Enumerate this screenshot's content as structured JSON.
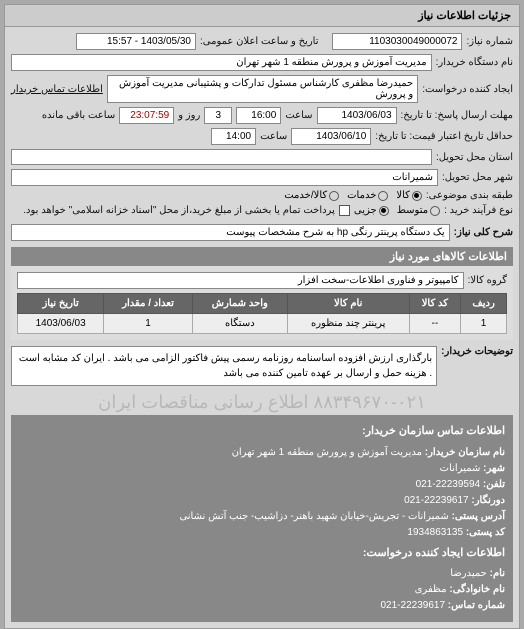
{
  "panel": {
    "title": "جزئیات اطلاعات نیاز"
  },
  "top": {
    "req_no_label": "شماره نیاز:",
    "req_no": "1103030049000072",
    "announce_label": "تاریخ و ساعت اعلان عمومی:",
    "announce": "1403/05/30 - 15:57",
    "dept_label": "نام دستگاه خریدار:",
    "dept": "مدیریت آموزش و پرورش منطقه 1 شهر تهران",
    "creator_label": "ایجاد کننده درخواست:",
    "creator": "حمیدرضا مظفری کارشناس مسئول تدارکات و پشتیبانی مدیریت آموزش و پرورش",
    "buyer_contact_label": "اطلاعات تماس خریدار",
    "deadline_from_label": "مهلت ارسال پاسخ: تا تاریخ:",
    "deadline_date": "1403/06/03",
    "time_label": "ساعت",
    "deadline_time": "16:00",
    "days_label": "روز و",
    "days": "3",
    "remain_time": "23:07:59",
    "remain_label": "ساعت باقی مانده",
    "validity_label": "حداقل تاریخ اعتبار قیمت: تا تاریخ:",
    "validity_date": "1403/06/10",
    "validity_time": "14:00",
    "province_label": "استان محل تحویل:",
    "province": "",
    "city_label": "شهر محل تحویل:",
    "city": "شمیرانات",
    "packaging_label": "طبقه بندی موضوعی:",
    "radio_goods": "کالا",
    "radio_services": "خدمات",
    "radio_goods_services": "کالا/خدمت",
    "purchase_type_label": "نوع فرآیند خرید :",
    "radio_medium": "متوسط",
    "radio_partial": "جزیی",
    "purchase_note": "پرداخت تمام یا بخشی از مبلغ خرید،از محل \"اسناد خزانه اسلامی\" خواهد بود.",
    "desc_label": "شرح کلی نیاز:",
    "desc": "یک دستگاه پرینتر رنگی hp به شرح مشخصات پیوست"
  },
  "goods_section": {
    "title": "اطلاعات کالاهای مورد نیاز",
    "group_label": "گروه کالا:",
    "group": "کامپیوتر و فناوری اطلاعات-سخت افزار",
    "table": {
      "headers": [
        "ردیف",
        "کد کالا",
        "نام کالا",
        "واحد شمارش",
        "تعداد / مقدار",
        "تاریخ نیاز"
      ],
      "rows": [
        [
          "1",
          "--",
          "پرینتر چند منظوره",
          "دستگاه",
          "1",
          "1403/06/03"
        ]
      ]
    }
  },
  "notes": {
    "label": "توضیحات خریدار:",
    "text": "بارگذاری ارزش افزوده اساسنامه روزنامه رسمی پیش فاکتور الزامی می باشد . ایران کد مشابه است . هزینه حمل و ارسال بر عهده تامین کننده می باشد"
  },
  "watermark": "۸۸۳۴۹۶۷۰-۰۲۱ اطلاع رسانی مناقصات ایران",
  "contact": {
    "heading": "اطلاعات تماس سازمان خریدار:",
    "org_label": "نام سازمان خریدار:",
    "org": "مدیریت آموزش و پرورش منطقه 1 شهر تهران",
    "city_label": "شهر:",
    "city": "شمیرانات",
    "tel_label": "تلفن:",
    "tel": "22239594-021",
    "fax_label": "دورنگار:",
    "fax": "22239617-021",
    "addr_label": "آدرس پستی:",
    "addr": "شمیرانات - تجریش-خیابان شهید باهنر- دزاشیب- جنب آتش نشانی",
    "postal_label": "کد پستی:",
    "postal": "1934863135",
    "req_creator_heading": "اطلاعات ایجاد کننده درخواست:",
    "name_label": "نام:",
    "name": "حمیدرضا",
    "family_label": "نام خانوادگی:",
    "family": "مظفری",
    "contact_tel_label": "شماره تماس:",
    "contact_tel": "22239617-021"
  }
}
